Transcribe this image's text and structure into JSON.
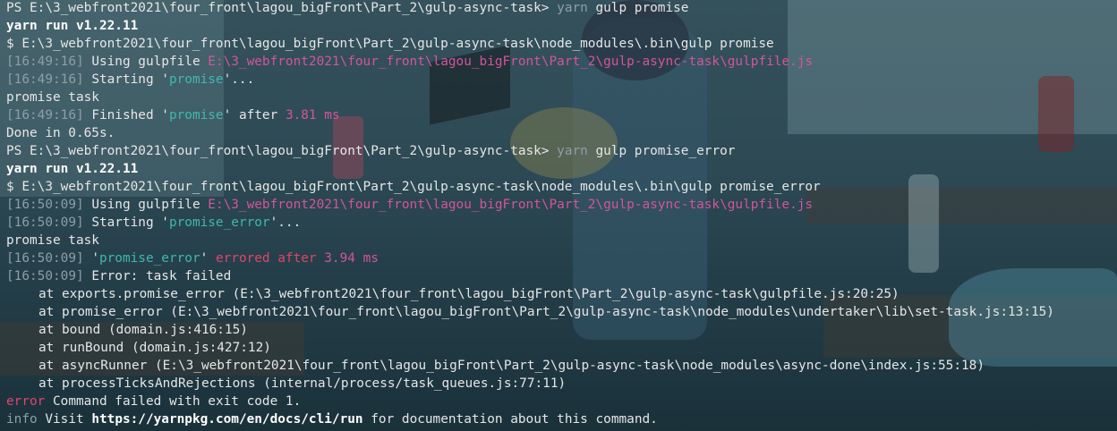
{
  "terminal": {
    "lines": [
      {
        "type": "prompt",
        "prompt": "PS E:\\3_webfront2021\\four_front\\lagou_bigFront\\Part_2\\gulp-async-task>",
        "cmd1": "yarn",
        "cmd2": "gulp promise"
      },
      {
        "type": "bold",
        "text": "yarn run v1.22.11"
      },
      {
        "type": "plain",
        "text": "$ E:\\3_webfront2021\\four_front\\lagou_bigFront\\Part_2\\gulp-async-task\\node_modules\\.bin\\gulp promise"
      },
      {
        "type": "using",
        "time": "16:49:16",
        "label": "Using gulpfile",
        "path": "E:\\3_webfront2021\\four_front\\lagou_bigFront\\Part_2\\gulp-async-task\\gulpfile.js"
      },
      {
        "type": "starting",
        "time": "16:49:16",
        "label": "Starting",
        "task": "promise"
      },
      {
        "type": "plain",
        "text": "promise task"
      },
      {
        "type": "finished",
        "time": "16:49:16",
        "label": "Finished",
        "task": "promise",
        "after": "after",
        "duration": "3.81 ms"
      },
      {
        "type": "plain",
        "text": "Done in 0.65s."
      },
      {
        "type": "prompt",
        "prompt": "PS E:\\3_webfront2021\\four_front\\lagou_bigFront\\Part_2\\gulp-async-task>",
        "cmd1": "yarn",
        "cmd2": "gulp promise_error"
      },
      {
        "type": "bold",
        "text": "yarn run v1.22.11"
      },
      {
        "type": "plain",
        "text": "$ E:\\3_webfront2021\\four_front\\lagou_bigFront\\Part_2\\gulp-async-task\\node_modules\\.bin\\gulp promise_error"
      },
      {
        "type": "using",
        "time": "16:50:09",
        "label": "Using gulpfile",
        "path": "E:\\3_webfront2021\\four_front\\lagou_bigFront\\Part_2\\gulp-async-task\\gulpfile.js"
      },
      {
        "type": "starting",
        "time": "16:50:09",
        "label": "Starting",
        "task": "promise_error"
      },
      {
        "type": "plain",
        "text": "promise task"
      },
      {
        "type": "errored",
        "time": "16:50:09",
        "task": "promise_error",
        "errored": "errored after",
        "duration": "3.94 ms"
      },
      {
        "type": "tsplain",
        "time": "16:50:09",
        "text": "Error: task failed"
      },
      {
        "type": "stack",
        "text": "at exports.promise_error (E:\\3_webfront2021\\four_front\\lagou_bigFront\\Part_2\\gulp-async-task\\gulpfile.js:20:25)"
      },
      {
        "type": "stack",
        "text": "at promise_error (E:\\3_webfront2021\\four_front\\lagou_bigFront\\Part_2\\gulp-async-task\\node_modules\\undertaker\\lib\\set-task.js:13:15)"
      },
      {
        "type": "stack",
        "text": "at bound (domain.js:416:15)"
      },
      {
        "type": "stack",
        "text": "at runBound (domain.js:427:12)"
      },
      {
        "type": "stack",
        "text": "at asyncRunner (E:\\3_webfront2021\\four_front\\lagou_bigFront\\Part_2\\gulp-async-task\\node_modules\\async-done\\index.js:55:18)"
      },
      {
        "type": "stack",
        "text": "at processTicksAndRejections (internal/process/task_queues.js:77:11)"
      },
      {
        "type": "error",
        "label": "error",
        "text": "Command failed with exit code 1."
      },
      {
        "type": "info",
        "label": "info",
        "pre": "Visit",
        "url": "https://yarnpkg.com/en/docs/cli/run",
        "post": "for documentation about this command."
      }
    ]
  },
  "colors": {
    "text": "#e6e6e6",
    "dim": "#8e9ea6",
    "magenta": "#d3549d",
    "cyan": "#3fb8b0",
    "red": "#e0456a"
  }
}
